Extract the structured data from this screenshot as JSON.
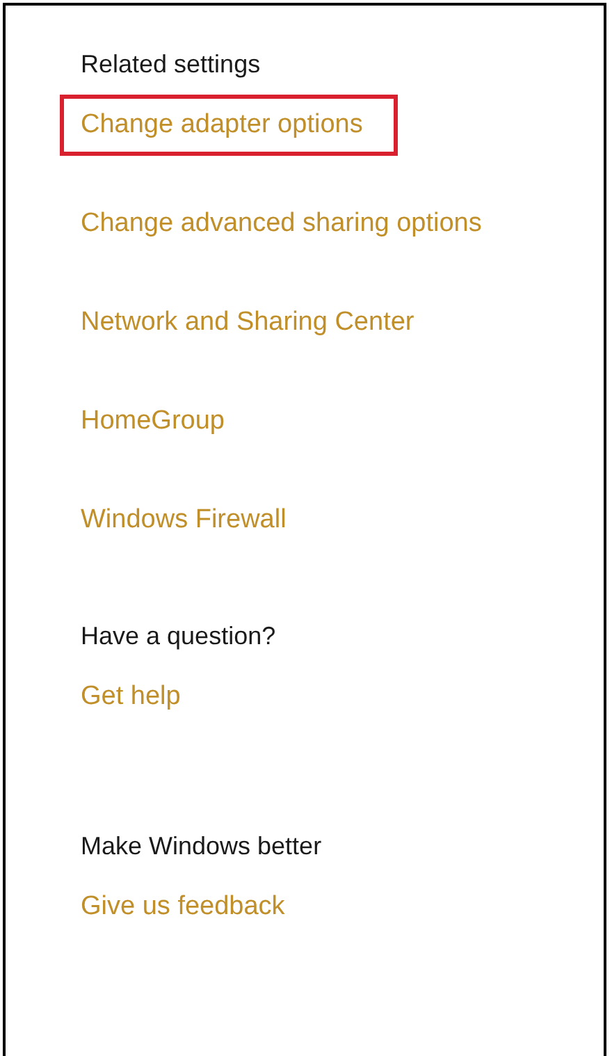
{
  "sections": [
    {
      "heading": "Related settings",
      "links": [
        {
          "label": "Change adapter options",
          "highlighted": true
        },
        {
          "label": "Change advanced sharing options",
          "highlighted": false
        },
        {
          "label": "Network and Sharing Center",
          "highlighted": false
        },
        {
          "label": "HomeGroup",
          "highlighted": false
        },
        {
          "label": "Windows Firewall",
          "highlighted": false
        }
      ]
    },
    {
      "heading": "Have a question?",
      "links": [
        {
          "label": "Get help",
          "highlighted": false
        }
      ]
    },
    {
      "heading": "Make Windows better",
      "links": [
        {
          "label": "Give us feedback",
          "highlighted": false
        }
      ]
    }
  ]
}
